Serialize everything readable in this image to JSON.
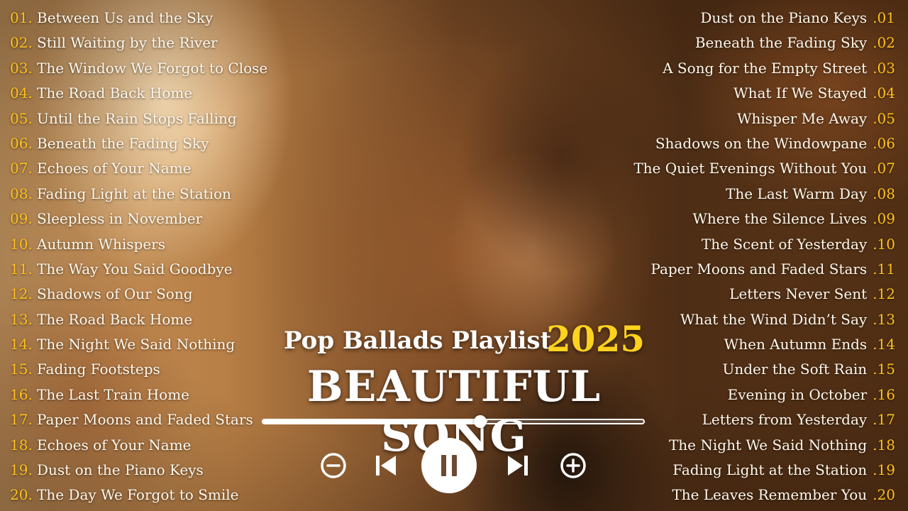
{
  "left_playlist": [
    {
      "num": "01.",
      "title": "Between Us and the Sky"
    },
    {
      "num": "02.",
      "title": "Still Waiting by the River"
    },
    {
      "num": "03.",
      "title": "The Window We Forgot to Close"
    },
    {
      "num": "04.",
      "title": "The Road Back Home"
    },
    {
      "num": "05.",
      "title": "Until the Rain Stops Falling"
    },
    {
      "num": "06.",
      "title": "Beneath the Fading Sky"
    },
    {
      "num": "07.",
      "title": "Echoes of Your Name"
    },
    {
      "num": "08.",
      "title": "Fading Light at the Station"
    },
    {
      "num": "09.",
      "title": "Sleepless in November"
    },
    {
      "num": "10.",
      "title": "Autumn Whispers"
    },
    {
      "num": "11.",
      "title": "The Way You Said Goodbye"
    },
    {
      "num": "12.",
      "title": "Shadows of Our Song"
    },
    {
      "num": "13.",
      "title": "The Road Back Home"
    },
    {
      "num": "14.",
      "title": "The Night We Said Nothing"
    },
    {
      "num": "15.",
      "title": "Fading Footsteps"
    },
    {
      "num": "16.",
      "title": "The Last Train Home"
    },
    {
      "num": "17.",
      "title": "Paper Moons and Faded Stars"
    },
    {
      "num": "18.",
      "title": "Echoes of Your Name"
    },
    {
      "num": "19.",
      "title": "Dust on the Piano Keys"
    },
    {
      "num": "20.",
      "title": "The Day We Forgot to Smile"
    }
  ],
  "right_playlist": [
    {
      "num": ".01",
      "title": "Dust on the Piano Keys"
    },
    {
      "num": ".02",
      "title": "Beneath the Fading Sky"
    },
    {
      "num": ".03",
      "title": "A Song for the Empty Street"
    },
    {
      "num": ".04",
      "title": "What If We Stayed"
    },
    {
      "num": ".05",
      "title": "Whisper Me Away"
    },
    {
      "num": ".06",
      "title": "Shadows on the Windowpane"
    },
    {
      "num": ".07",
      "title": "The Quiet Evenings Without You"
    },
    {
      "num": ".08",
      "title": "The Last Warm Day"
    },
    {
      "num": ".09",
      "title": "Where the Silence Lives"
    },
    {
      "num": ".10",
      "title": "The Scent of Yesterday"
    },
    {
      "num": ".11",
      "title": "Paper Moons and Faded Stars"
    },
    {
      "num": ".12",
      "title": "Letters Never Sent"
    },
    {
      "num": ".13",
      "title": "What the Wind Didn’t Say"
    },
    {
      "num": ".14",
      "title": "When Autumn Ends"
    },
    {
      "num": ".15",
      "title": "Under the Soft Rain"
    },
    {
      "num": ".16",
      "title": "Evening in October"
    },
    {
      "num": ".17",
      "title": "Letters from Yesterday"
    },
    {
      "num": ".18",
      "title": "The Night We Said Nothing"
    },
    {
      "num": ".19",
      "title": "Fading Light at the Station"
    },
    {
      "num": ".20",
      "title": "The Leaves Remember You"
    }
  ],
  "center": {
    "subtitle": "Pop Ballads Playlist",
    "year": "2025",
    "title": "BEAUTIFUL SONG"
  },
  "player": {
    "progress_fraction": 0.57,
    "controls": [
      "minus-circle-icon",
      "skip-previous-icon",
      "pause-icon",
      "skip-next-icon",
      "plus-circle-icon"
    ]
  },
  "colors": {
    "accent_number": "#ffc21a",
    "year": "#ffd21e",
    "text": "#fff8ec"
  }
}
